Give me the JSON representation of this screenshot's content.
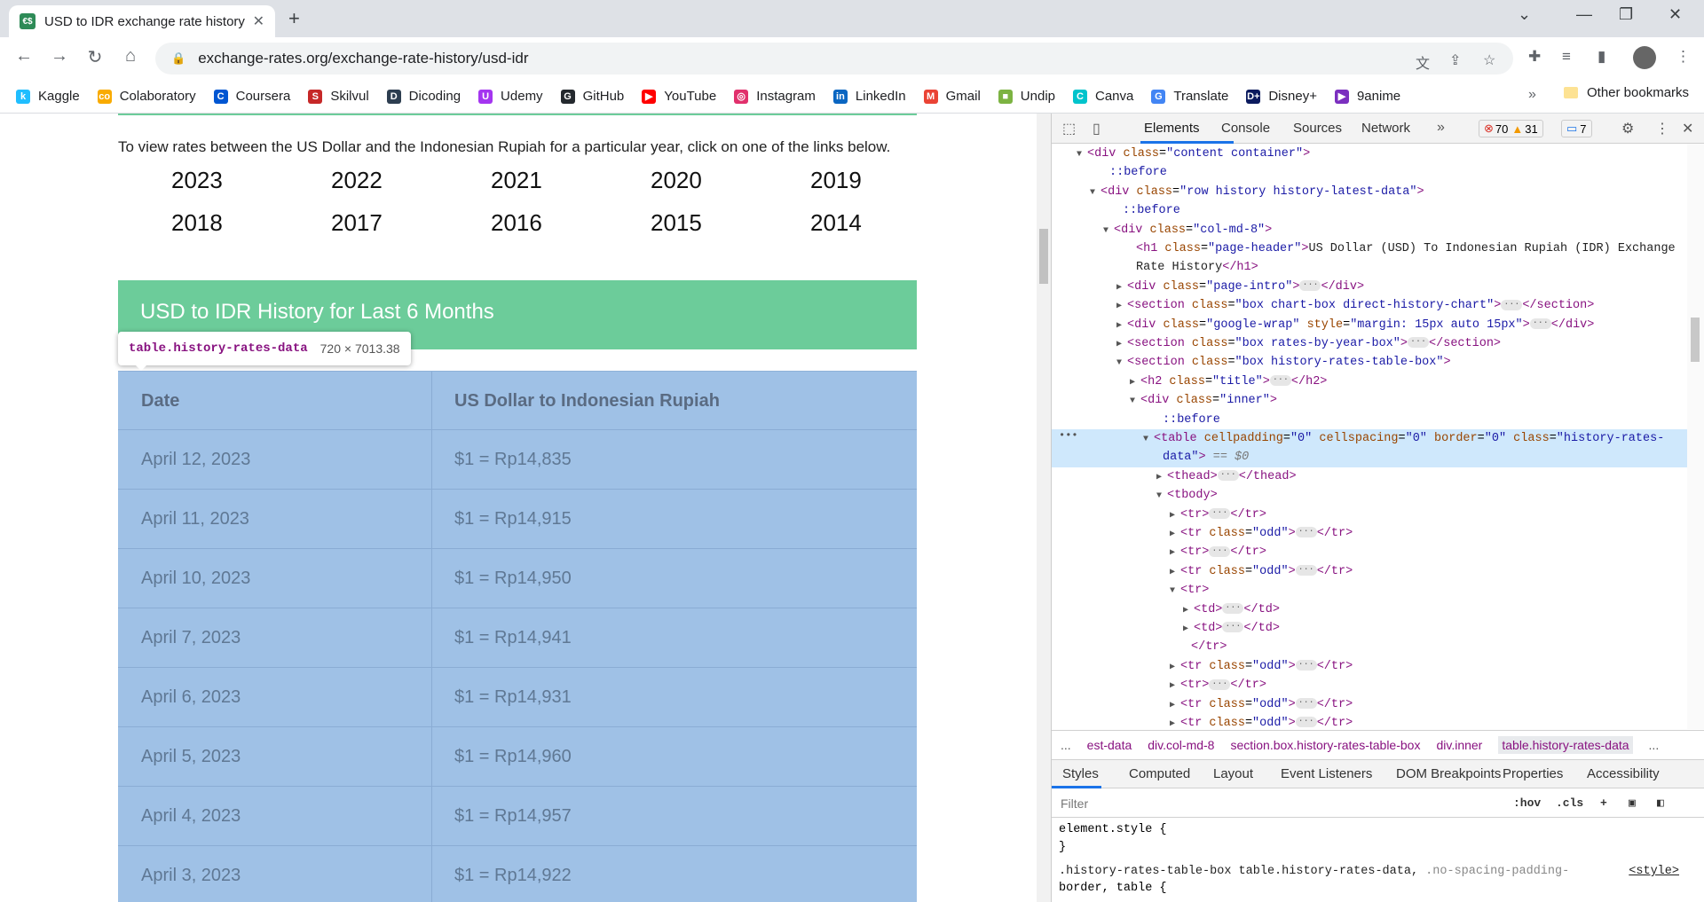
{
  "browser": {
    "tab_title": "USD to IDR exchange rate history",
    "favicon_text": "€$",
    "url": "exchange-rates.org/exchange-rate-history/usd-idr"
  },
  "bookmarks": [
    {
      "label": "Kaggle",
      "color": "#20beff",
      "icon": "k"
    },
    {
      "label": "Colaboratory",
      "color": "#f9ab00",
      "icon": "co"
    },
    {
      "label": "Coursera",
      "color": "#0056d2",
      "icon": "C"
    },
    {
      "label": "Skilvul",
      "color": "#c62828",
      "icon": "S"
    },
    {
      "label": "Dicoding",
      "color": "#2d3e50",
      "icon": "D"
    },
    {
      "label": "Udemy",
      "color": "#a435f0",
      "icon": "U"
    },
    {
      "label": "GitHub",
      "color": "#24292e",
      "icon": "G"
    },
    {
      "label": "YouTube",
      "color": "#ff0000",
      "icon": "▶"
    },
    {
      "label": "Instagram",
      "color": "#e1306c",
      "icon": "◎"
    },
    {
      "label": "LinkedIn",
      "color": "#0a66c2",
      "icon": "in"
    },
    {
      "label": "Gmail",
      "color": "#ea4335",
      "icon": "M"
    },
    {
      "label": "Undip",
      "color": "#7cb342",
      "icon": "■"
    },
    {
      "label": "Canva",
      "color": "#00c4cc",
      "icon": "C"
    },
    {
      "label": "Translate",
      "color": "#4285f4",
      "icon": "G"
    },
    {
      "label": "Disney+",
      "color": "#0b1a5e",
      "icon": "D+"
    },
    {
      "label": "9anime",
      "color": "#7b2fbf",
      "icon": "▶"
    }
  ],
  "other_bookmarks": "Other bookmarks",
  "page": {
    "intro": "To view rates between the US Dollar and the Indonesian Rupiah for a particular year, click on one of the links below.",
    "years": [
      "2023",
      "2022",
      "2021",
      "2020",
      "2019",
      "2018",
      "2017",
      "2016",
      "2015",
      "2014"
    ],
    "section_title": "USD to IDR History for Last 6 Months",
    "tooltip_name": "table.history-rates-data",
    "tooltip_size": "720 × 7013.38",
    "table_headers": [
      "Date",
      "US Dollar to Indonesian Rupiah"
    ],
    "rows": [
      [
        "April 12, 2023",
        "$1 = Rp14,835"
      ],
      [
        "April 11, 2023",
        "$1 = Rp14,915"
      ],
      [
        "April 10, 2023",
        "$1 = Rp14,950"
      ],
      [
        "April 7, 2023",
        "$1 = Rp14,941"
      ],
      [
        "April 6, 2023",
        "$1 = Rp14,931"
      ],
      [
        "April 5, 2023",
        "$1 = Rp14,960"
      ],
      [
        "April 4, 2023",
        "$1 = Rp14,957"
      ],
      [
        "April 3, 2023",
        "$1 = Rp14,922"
      ]
    ]
  },
  "devtools": {
    "tabs": [
      "Elements",
      "Console",
      "Sources",
      "Network"
    ],
    "errors": "70",
    "warnings": "31",
    "messages": "7",
    "breadcrumbs": [
      "...",
      "est-data",
      "div.col-md-8",
      "section.box.history-rates-table-box",
      "div.inner",
      "table.history-rates-data",
      "..."
    ],
    "panel_tabs": [
      "Styles",
      "Computed",
      "Layout",
      "Event Listeners",
      "DOM Breakpoints",
      "Properties",
      "Accessibility"
    ],
    "filter_placeholder": "Filter",
    "hov": ":hov",
    ".cls": ".cls",
    "css_element": "element.style {",
    "css_close": "}",
    "css_rule1": ".history-rates-table-box table.history-rates-data,",
    "css_rule1_dim": " .no-spacing-padding-",
    "css_rule2": "border, table {",
    "css_source": "<style>"
  }
}
